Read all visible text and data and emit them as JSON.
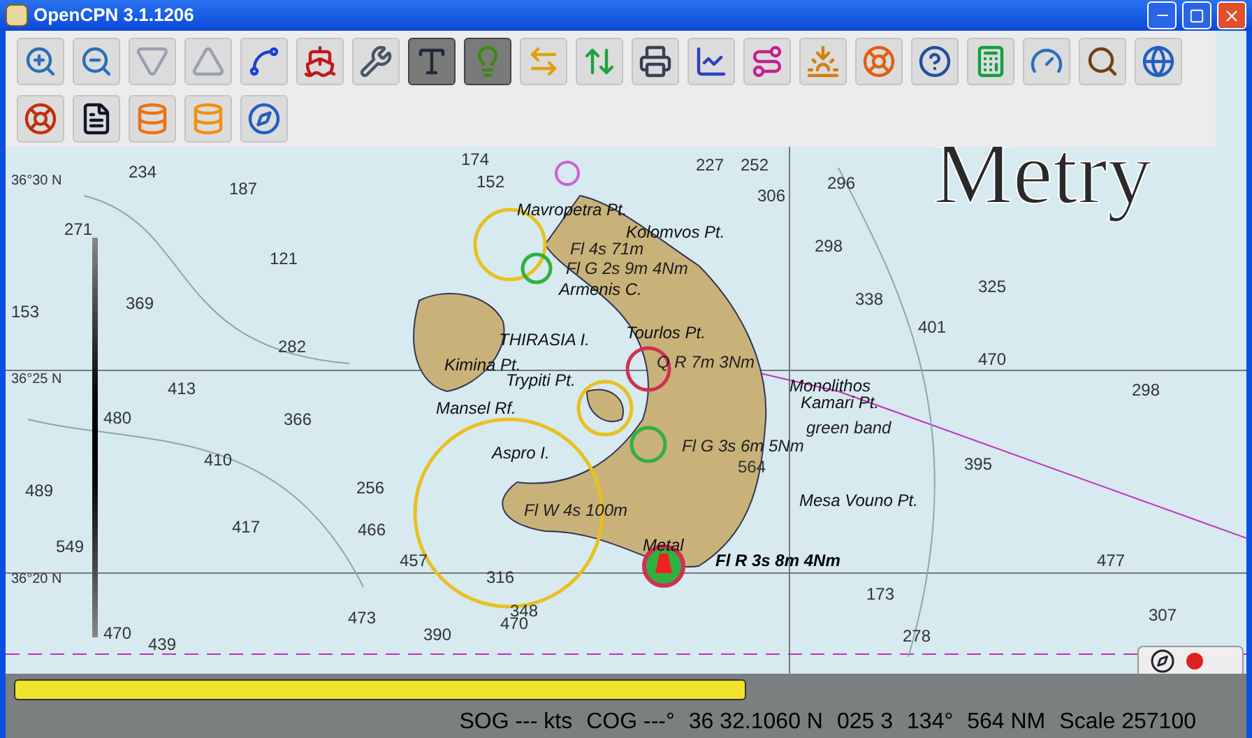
{
  "window": {
    "title": "OpenCPN 3.1.1206"
  },
  "toolbar": {
    "rows": [
      [
        {
          "selected": false
        },
        {
          "selected": false
        },
        {
          "selected": false
        },
        {
          "selected": false
        },
        {
          "selected": false
        },
        {
          "selected": false
        },
        {
          "selected": false
        },
        {
          "selected": true
        },
        {
          "selected": true
        },
        {
          "selected": false
        },
        {
          "selected": false
        },
        {
          "selected": false
        },
        {
          "selected": false
        },
        {
          "selected": false
        },
        {
          "selected": false
        },
        {
          "selected": false
        },
        {
          "selected": false
        },
        {
          "selected": false
        },
        {
          "selected": false
        },
        {
          "selected": false
        },
        {
          "selected": false
        }
      ],
      [
        {
          "selected": false
        },
        {
          "selected": false
        },
        {
          "selected": false
        },
        {
          "selected": false
        },
        {
          "selected": false
        }
      ]
    ]
  },
  "chart": {
    "overlay_title": "Metry",
    "latitudes": [
      "36°30 N",
      "36°25 N",
      "36°20 N"
    ],
    "place_names": [
      {
        "text": "Mavropetra Pt.",
        "kind": "name"
      },
      {
        "text": "Kolomvos Pt.",
        "kind": "name"
      },
      {
        "text": "Fl 4s 71m",
        "kind": "light"
      },
      {
        "text": "Fl G 2s 9m 4Nm",
        "kind": "light"
      },
      {
        "text": "Armenis C.",
        "kind": "name"
      },
      {
        "text": "THIRASIA I.",
        "kind": "name"
      },
      {
        "text": "Kimina Pt.",
        "kind": "name"
      },
      {
        "text": "Tourlos Pt.",
        "kind": "name"
      },
      {
        "text": "Trypiti Pt.",
        "kind": "name"
      },
      {
        "text": "Mansel Rf.",
        "kind": "name"
      },
      {
        "text": "Q R 7m 3Nm",
        "kind": "light"
      },
      {
        "text": "Monolithos",
        "kind": "name"
      },
      {
        "text": "Kamari Pt.",
        "kind": "name"
      },
      {
        "text": "green band",
        "kind": "light"
      },
      {
        "text": "Fl G 3s 6m 5Nm",
        "kind": "light"
      },
      {
        "text": "Aspro I.",
        "kind": "name"
      },
      {
        "text": "Mesa Vouno Pt.",
        "kind": "name"
      },
      {
        "text": "Fl W 4s 100m",
        "kind": "light"
      },
      {
        "text": "Metal",
        "kind": "name"
      },
      {
        "text": "Fl R 3s 8m 4Nm",
        "kind": "bold"
      }
    ],
    "depths": [
      "234",
      "187",
      "121",
      "369",
      "282",
      "413",
      "366",
      "410",
      "256",
      "417",
      "466",
      "457",
      "473",
      "439",
      "390",
      "470",
      "348",
      "316",
      "271",
      "480",
      "489",
      "549",
      "470",
      "153",
      "152",
      "174",
      "227",
      "252",
      "306",
      "296",
      "298",
      "338",
      "401",
      "470",
      "395",
      "298",
      "477",
      "173",
      "278",
      "564",
      "325",
      "307"
    ]
  },
  "progress": {
    "level": 0.6
  },
  "status_bar": [
    "SOG --- kts",
    "COG ---°",
    "36 32.1060 N",
    "025 3",
    "134°",
    "564 NM",
    "Scale 257100"
  ]
}
